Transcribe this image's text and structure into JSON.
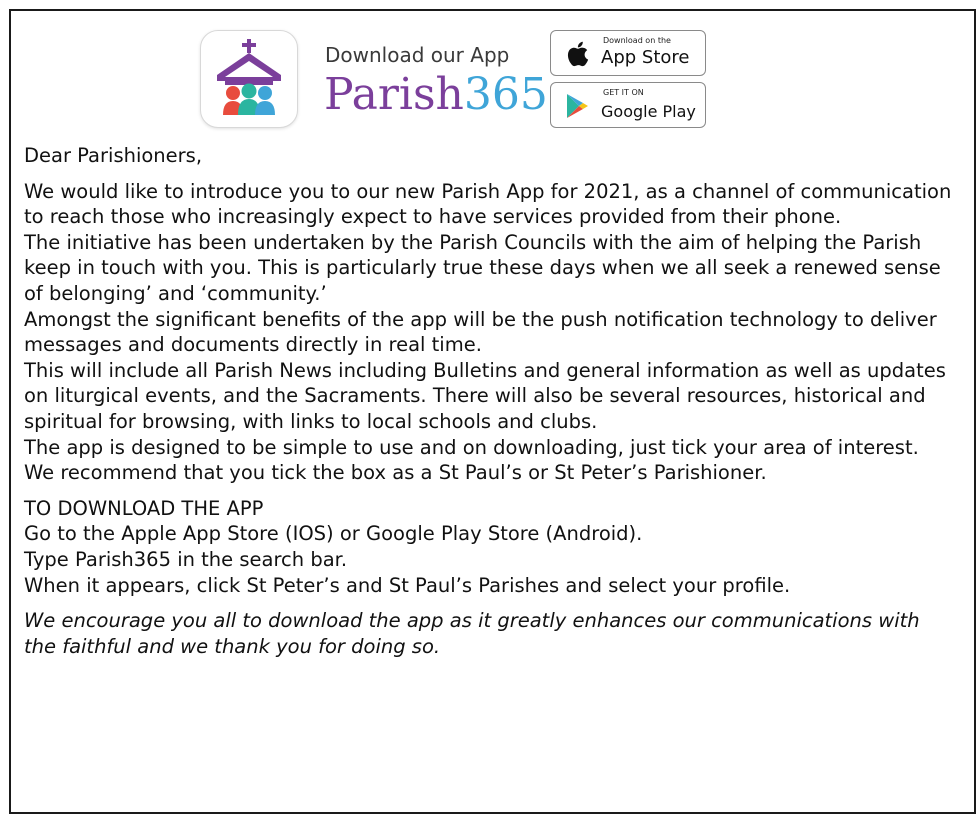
{
  "header": {
    "tagline": "Download our App",
    "brand_part1": "Parish",
    "brand_part2": "365",
    "apple_badge": {
      "small": "Download on the",
      "big": "App Store",
      "icon": "apple-icon"
    },
    "google_badge": {
      "small": "GET IT ON",
      "big": "Google Play",
      "icon": "google-play-icon"
    },
    "app_icon": "parish365-app-icon",
    "colors": {
      "purple": "#7b3f9b",
      "blue": "#3fa5d8",
      "red": "#e84c3d",
      "teal": "#2bb5a0"
    }
  },
  "letter": {
    "greeting": "Dear Parishioners,",
    "paragraphs": [
      "We would like to introduce you to our new Parish App for 2021, as a channel of communication to reach those who increasingly expect to have services provided from their phone.",
      "The initiative has been undertaken by the Parish Councils with the aim of helping the Parish keep in touch with you. This is particularly true these days when we all seek a renewed sense of belonging’ and ‘community.’",
      "Amongst the significant benefits of the app will be the push notification technology to deliver messages and documents directly in real time.",
      "This will include all Parish News including Bulletins and general information as well as updates on liturgical events, and the Sacraments. There will also be several resources, historical and spiritual for browsing, with links to local schools and clubs.",
      "The app is designed to be simple to use and on downloading, just tick your area of interest. We recommend that you tick the box as a St Paul’s or St Peter’s Parishioner."
    ],
    "download_heading": "TO DOWNLOAD THE APP",
    "download_steps": [
      "Go to the Apple App Store (IOS) or Google Play Store (Android).",
      "Type Parish365 in the search bar.",
      "When it appears, click St Peter’s and St Paul’s Parishes and select your profile."
    ],
    "closing": "We encourage you all to download the app as it greatly enhances our communications with the faithful and we thank you for doing so."
  }
}
